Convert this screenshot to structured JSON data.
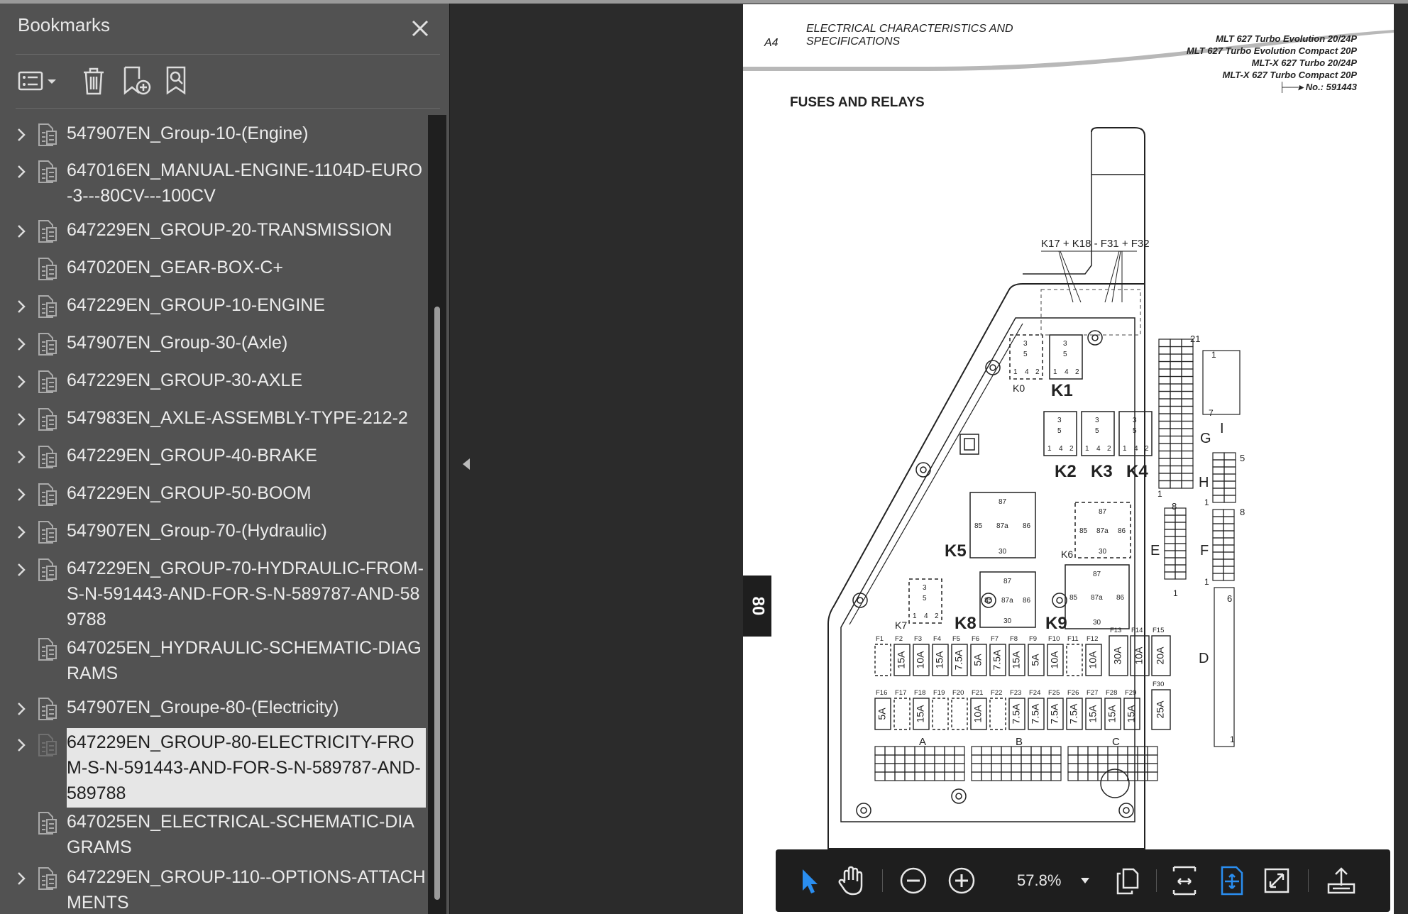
{
  "sidebar": {
    "title": "Bookmarks",
    "toolbar": {
      "options_icon": "list-options-icon",
      "delete_icon": "trash-icon",
      "add_icon": "add-bookmark-icon",
      "find_icon": "find-bookmark-icon"
    },
    "items": [
      {
        "label": "547907EN_Group-10-(Engine)",
        "expandable": true
      },
      {
        "label": "647016EN_MANUAL-ENGINE-1104D-EURO-3---80CV---100CV",
        "expandable": true
      },
      {
        "label": "647229EN_GROUP-20-TRANSMISSION",
        "expandable": true
      },
      {
        "label": "647020EN_GEAR-BOX-C+",
        "expandable": false
      },
      {
        "label": "647229EN_GROUP-10-ENGINE",
        "expandable": true
      },
      {
        "label": "547907EN_Group-30-(Axle)",
        "expandable": true
      },
      {
        "label": "647229EN_GROUP-30-AXLE",
        "expandable": true
      },
      {
        "label": "547983EN_AXLE-ASSEMBLY-TYPE-212-2",
        "expandable": true
      },
      {
        "label": "647229EN_GROUP-40-BRAKE",
        "expandable": true
      },
      {
        "label": "647229EN_GROUP-50-BOOM",
        "expandable": true
      },
      {
        "label": "547907EN_Group-70-(Hydraulic)",
        "expandable": true
      },
      {
        "label": "647229EN_GROUP-70-HYDRAULIC-FROM-S-N-591443-AND-FOR-S-N-589787-AND-589788",
        "expandable": true
      },
      {
        "label": "647025EN_HYDRAULIC-SCHEMATIC-DIAGRAMS",
        "expandable": false
      },
      {
        "label": "547907EN_Groupe-80-(Electricity)",
        "expandable": true
      },
      {
        "label": "647229EN_GROUP-80-ELECTRICITY-FROM-S-N-591443-AND-FOR-S-N-589787-AND-589788",
        "expandable": true,
        "selected": true
      },
      {
        "label": "647025EN_ELECTRICAL-SCHEMATIC-DIAGRAMS",
        "expandable": false
      },
      {
        "label": "647229EN_GROUP-110--OPTIONS-ATTACHMENTS",
        "expandable": true
      }
    ]
  },
  "document": {
    "page_code": "A4",
    "header_title_line1": "ELECTRICAL CHARACTERISTICS AND",
    "header_title_line2": "SPECIFICATIONS",
    "models": [
      "MLT 627 Turbo Evolution 20/24P",
      "MLT 627 Turbo Evolution Compact 20P",
      "MLT-X 627 Turbo 20/24P",
      "MLT-X 627 Turbo Compact 20P"
    ],
    "serial": "No.: 591443",
    "section_title": "FUSES AND RELAYS",
    "side_tab": "80",
    "diagram": {
      "top_label": "K17 + K18 - F31 + F32",
      "relays": [
        "K0",
        "K1",
        "K2",
        "K3",
        "K4",
        "K5",
        "K6",
        "K7",
        "K8",
        "K9"
      ],
      "connector_letters": [
        "G",
        "H",
        "I",
        "E",
        "F",
        "D",
        "A",
        "B",
        "C"
      ],
      "small_relay_pins": [
        "3",
        "5",
        "1",
        "4",
        "2"
      ],
      "big_relay_pins": [
        "85",
        "87a",
        "86",
        "30",
        "87"
      ],
      "fuse_row1": [
        {
          "id": "F1",
          "rating": ""
        },
        {
          "id": "F2",
          "rating": "15A"
        },
        {
          "id": "F3",
          "rating": "10A"
        },
        {
          "id": "F4",
          "rating": "15A"
        },
        {
          "id": "F5",
          "rating": "7.5A"
        },
        {
          "id": "F6",
          "rating": "5A"
        },
        {
          "id": "F7",
          "rating": "7.5A"
        },
        {
          "id": "F8",
          "rating": "15A"
        },
        {
          "id": "F9",
          "rating": "5A"
        },
        {
          "id": "F10",
          "rating": "10A"
        },
        {
          "id": "F11",
          "rating": ""
        },
        {
          "id": "F12",
          "rating": "10A"
        }
      ],
      "fuse_big": [
        {
          "id": "F13",
          "rating": "30A"
        },
        {
          "id": "F14",
          "rating": "10A"
        },
        {
          "id": "F15",
          "rating": "20A"
        }
      ],
      "fuse_row2": [
        {
          "id": "F16",
          "rating": "5A"
        },
        {
          "id": "F17",
          "rating": ""
        },
        {
          "id": "F18",
          "rating": "15A"
        },
        {
          "id": "F19",
          "rating": ""
        },
        {
          "id": "F20",
          "rating": ""
        },
        {
          "id": "F21",
          "rating": "10A"
        },
        {
          "id": "F22",
          "rating": ""
        },
        {
          "id": "F23",
          "rating": "7.5A"
        },
        {
          "id": "F24",
          "rating": "7.5A"
        },
        {
          "id": "F25",
          "rating": "7.5A"
        },
        {
          "id": "F26",
          "rating": "7.5A"
        },
        {
          "id": "F27",
          "rating": "15A"
        },
        {
          "id": "F28",
          "rating": "15A"
        },
        {
          "id": "F29",
          "rating": "15A"
        }
      ],
      "fuse_f30": {
        "id": "F30",
        "rating": "25A"
      },
      "num_labels": [
        "21",
        "1",
        "5",
        "1",
        "8",
        "1",
        "8",
        "1",
        "6",
        "1",
        "7",
        "1"
      ]
    }
  },
  "viewer_toolbar": {
    "zoom_value": "57.8%",
    "icons": [
      "select-arrow-icon",
      "hand-pan-icon",
      "zoom-out-icon",
      "zoom-in-icon",
      "page-view-icon",
      "fit-width-icon",
      "fit-page-icon",
      "fullscreen-icon",
      "export-icon"
    ],
    "accent_color": "#2a8ef0"
  }
}
